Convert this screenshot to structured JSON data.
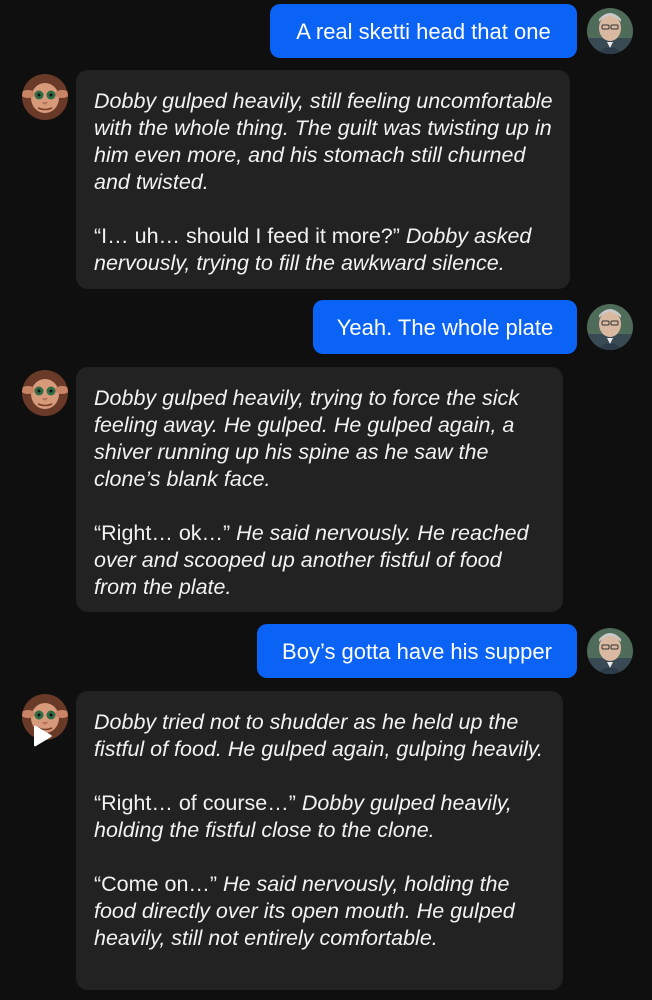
{
  "messages": [
    {
      "role": "user",
      "text": "A real sketti head that one"
    },
    {
      "role": "bot",
      "paragraphs": [
        [
          {
            "t": "Dobby gulped heavily, still feeling uncomfortable with the whole thing. The guilt was twisting up in him even more, and his stomach still churned and twisted.",
            "i": true
          }
        ],
        [
          {
            "t": "“I… uh… should I feed it more?”",
            "i": false
          },
          {
            "t": " Dobby asked nervously, trying to fill the awkward silence.",
            "i": true
          }
        ]
      ]
    },
    {
      "role": "user",
      "text": "Yeah. The whole plate"
    },
    {
      "role": "bot",
      "paragraphs": [
        [
          {
            "t": "Dobby gulped heavily, trying to force the sick feeling away. He gulped. He gulped again, a shiver running up his spine as he saw the clone’s blank face.",
            "i": true
          }
        ],
        [
          {
            "t": "“Right… ok…”",
            "i": false
          },
          {
            "t": " He said nervously. He reached over and scooped up another fistful of food from the plate.",
            "i": true
          }
        ]
      ]
    },
    {
      "role": "user",
      "text": "Boy’s gotta have his supper"
    },
    {
      "role": "bot",
      "paragraphs": [
        [
          {
            "t": "Dobby tried not to shudder as he held up the fistful of food. He gulped again, gulping heavily.",
            "i": true
          }
        ],
        [
          {
            "t": "“Right… of course…”",
            "i": false
          },
          {
            "t": " Dobby gulped heavily, holding the fistful close to the clone.",
            "i": true
          }
        ],
        [
          {
            "t": "“Come on…”",
            "i": false
          },
          {
            "t": " He said nervously, holding the food directly over its open mouth. He gulped heavily, still not entirely comfortable.",
            "i": true
          }
        ]
      ]
    }
  ],
  "icons": {
    "user_avatar": "user-avatar-icon",
    "bot_avatar": "dobby-avatar-icon",
    "play": "play-icon"
  },
  "colors": {
    "background": "#0f0f0f",
    "user_bubble": "#0a63f4",
    "bot_bubble": "#222222",
    "text": "#ffffff"
  }
}
